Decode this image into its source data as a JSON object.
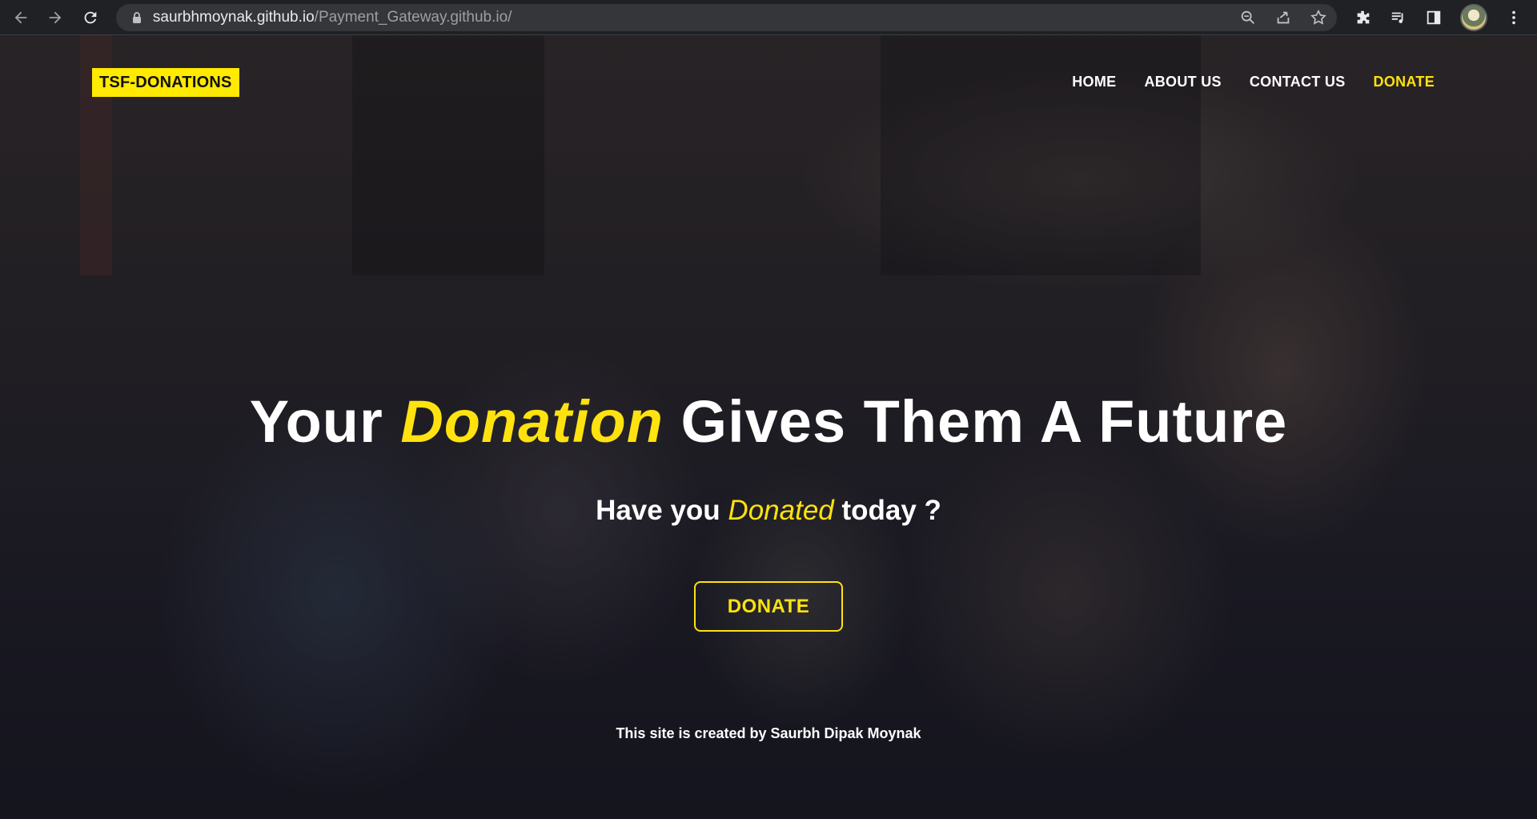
{
  "browser": {
    "url_host": "saurbhmoynak.github.io",
    "url_path": "/Payment_Gateway.github.io/",
    "icons": [
      "back-icon",
      "forward-icon",
      "reload-icon",
      "lock-icon",
      "zoom-icon",
      "share-icon",
      "star-icon",
      "extensions-icon",
      "media-icon",
      "sidepanel-icon",
      "profile-avatar",
      "menu-icon"
    ]
  },
  "site": {
    "logo": "TSF-DONATIONS",
    "nav": [
      {
        "label": "HOME"
      },
      {
        "label": "ABOUT US"
      },
      {
        "label": "CONTACT US"
      },
      {
        "label": "DONATE"
      }
    ],
    "active_nav": "DONATE",
    "headline": {
      "before": "Your ",
      "accent": "Donation",
      "after": " Gives Them A Future"
    },
    "subline": {
      "before": "Have you ",
      "accent": "Donated",
      "after": " today ?"
    },
    "cta_label": "DONATE",
    "credit": "This site is created by Saurbh Dipak Moynak"
  },
  "colors": {
    "accent": "#ffe20f",
    "logo_bg": "#ffea00",
    "chrome_bg": "#202124",
    "text": "#ffffff"
  }
}
